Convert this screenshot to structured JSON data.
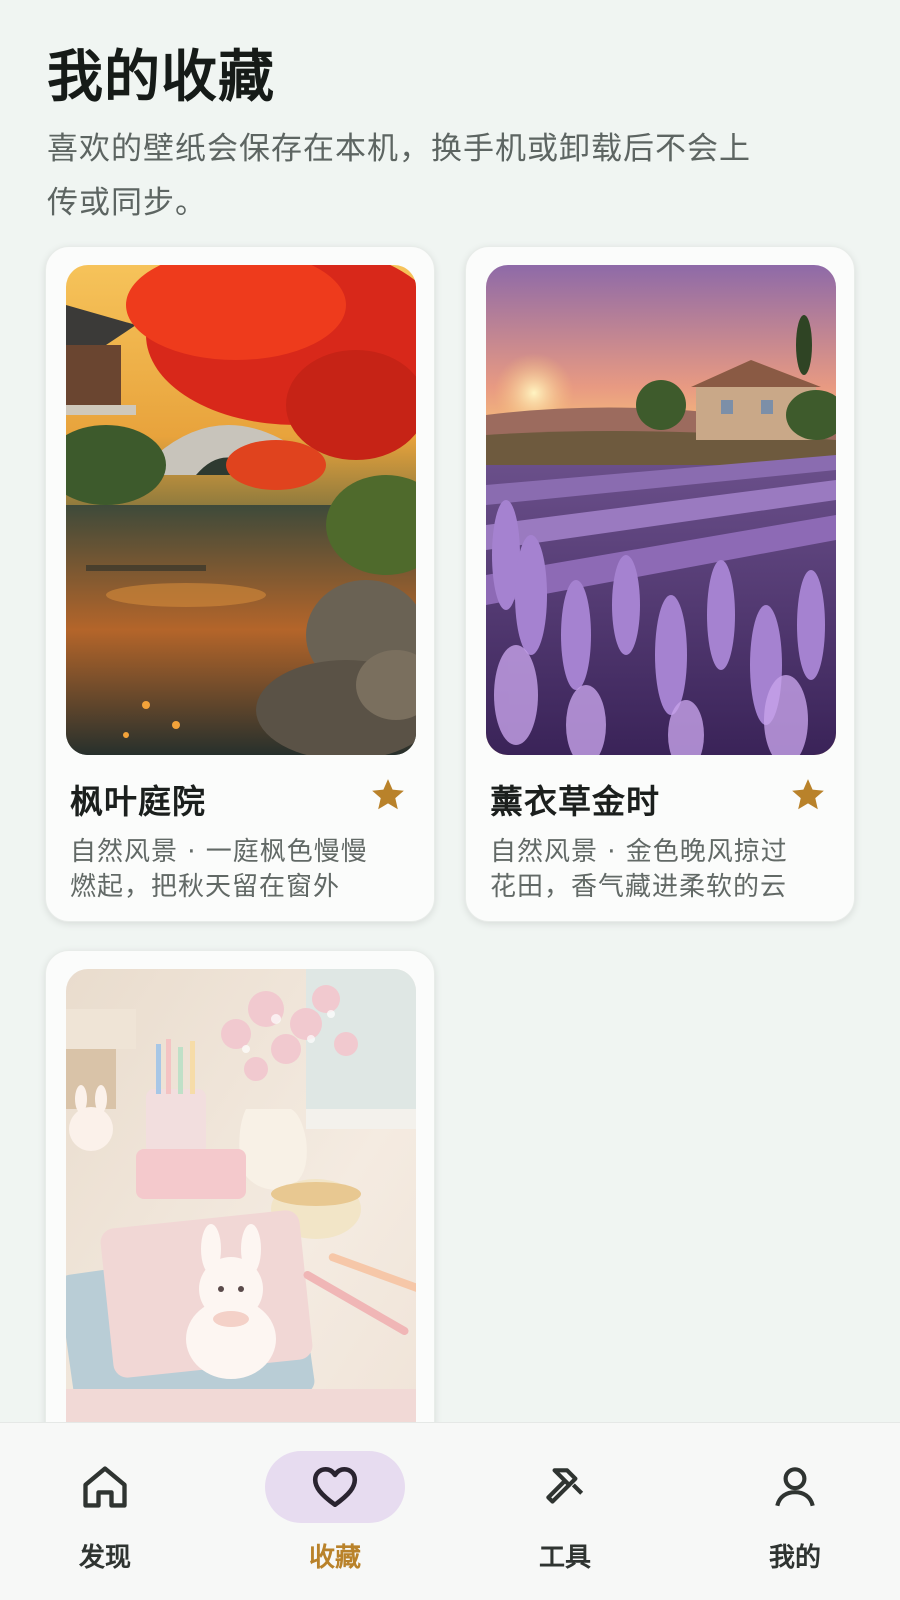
{
  "header": {
    "title": "我的收藏",
    "subtitle_line1": "喜欢的壁纸会保存在本机，换手机或卸载后不会上",
    "subtitle_line2": "传或同步。"
  },
  "favorites": [
    {
      "title": "枫叶庭院",
      "desc_line1": "自然风景 · 一庭枫色慢慢",
      "desc_line2": "燃起，把秋天留在窗外",
      "favorited": true,
      "icon": "star-icon"
    },
    {
      "title": "薰衣草金时",
      "desc_line1": "自然风景 · 金色晚风掠过",
      "desc_line2": "花田，香气藏进柔软的云",
      "favorited": true,
      "icon": "star-icon"
    },
    {
      "title": "",
      "desc_line1": "",
      "desc_line2": "",
      "favorited": true
    }
  ],
  "nav": {
    "items": [
      {
        "label": "发现",
        "icon": "home-icon",
        "active": false
      },
      {
        "label": "收藏",
        "icon": "heart-icon",
        "active": true
      },
      {
        "label": "工具",
        "icon": "hammer-icon",
        "active": false
      },
      {
        "label": "我的",
        "icon": "person-icon",
        "active": false
      }
    ]
  },
  "colors": {
    "background": "#f0f5f2",
    "accent": "#b9822a",
    "active_pill": "#e7dcf0",
    "star": "#b9822a"
  }
}
